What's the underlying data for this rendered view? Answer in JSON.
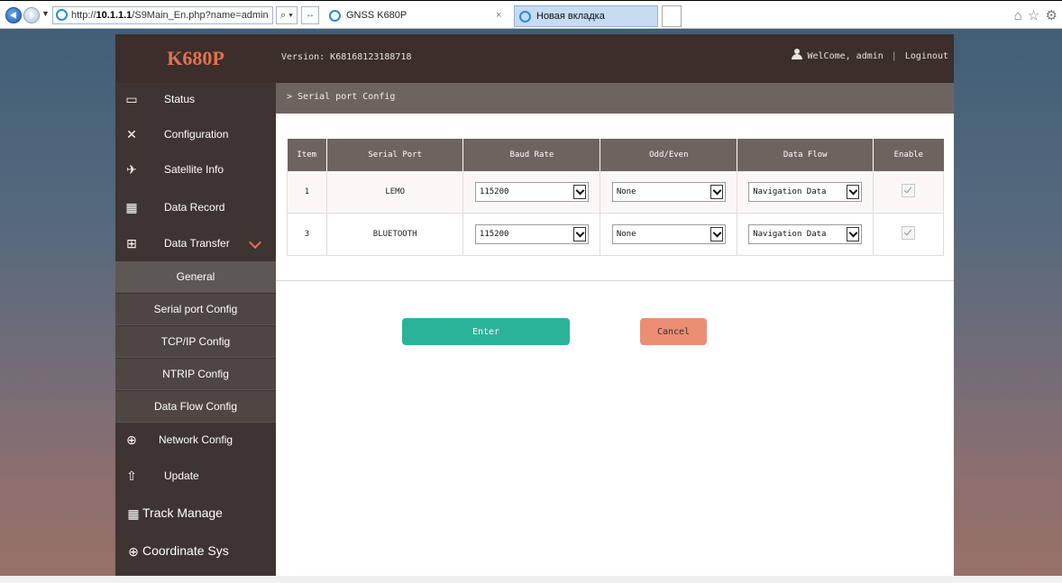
{
  "browser": {
    "url_prefix": "http://",
    "url_host": "10.1.1.1",
    "url_path": "/S9Main_En.php?name=admin",
    "search_icon": "⌕ ▾",
    "refresh_icon": "↔",
    "tabs": [
      {
        "title": "GNSS K680P",
        "active": false
      },
      {
        "title": "Новая вкладка",
        "active": true
      }
    ],
    "tab_close": "×",
    "tools_icons": "⌂ ☆ ⚙"
  },
  "header": {
    "logo": "K680P",
    "version": "Version: K68168123188718",
    "welcome": "WelCome, admin",
    "separator": "|",
    "logout": "Loginout"
  },
  "sidebar": {
    "items": [
      {
        "label": "Status",
        "icon": "monitor-icon",
        "glyph": "▭"
      },
      {
        "label": "Configuration",
        "icon": "tools-icon",
        "glyph": "✕"
      },
      {
        "label": "Satellite Info",
        "icon": "satellite-icon",
        "glyph": "✈"
      },
      {
        "label": "Data Record",
        "icon": "calendar-icon",
        "glyph": "▦"
      },
      {
        "label": "Data Transfer",
        "icon": "transfer-icon",
        "glyph": "⊞"
      }
    ],
    "sub_items": [
      {
        "label": "General"
      },
      {
        "label": "Serial port Config"
      },
      {
        "label": "TCP/IP Config"
      },
      {
        "label": "NTRIP Config"
      },
      {
        "label": "Data Flow Config"
      }
    ],
    "lower_items": [
      {
        "label": "Network Config",
        "icon": "globe-icon",
        "glyph": "⊕"
      },
      {
        "label": "Update",
        "icon": "upload-icon",
        "glyph": "⇧"
      },
      {
        "label": "Track Manage",
        "icon": "calendar-icon",
        "glyph": "▦"
      },
      {
        "label": "Coordinate Sys",
        "icon": "globe-icon",
        "glyph": "⊕"
      }
    ]
  },
  "main": {
    "breadcrumb": "> Serial port Config",
    "table": {
      "headers": [
        "Item",
        "Serial Port",
        "Baud Rate",
        "Odd/Even",
        "Data Flow",
        "Enable"
      ],
      "rows": [
        {
          "item": "1",
          "port": "LEMO",
          "baud": "115200",
          "parity": "None",
          "flow": "Navigation Data",
          "enabled": true
        },
        {
          "item": "3",
          "port": "BLUETOOTH",
          "baud": "115200",
          "parity": "None",
          "flow": "Navigation Data",
          "enabled": true
        }
      ]
    },
    "enter_label": "Enter",
    "cancel_label": "Cancel"
  },
  "colors": {
    "accent": "#e4714f",
    "enter": "#2bb39a",
    "cancel": "#eb8e73",
    "header_bg": "#3b2e2b"
  }
}
